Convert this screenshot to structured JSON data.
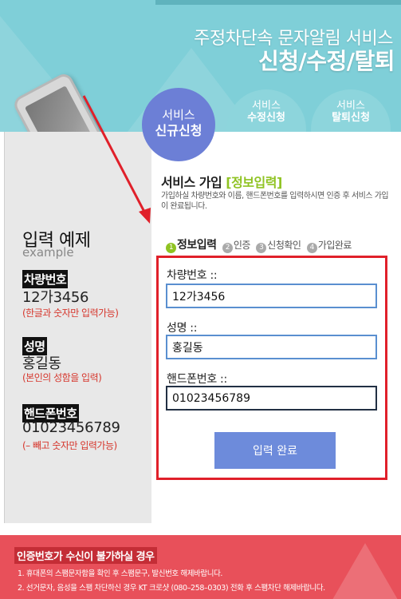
{
  "header": {
    "title_line1": "주정차단속 문자알림 서비스",
    "title_line2": "신청/수정/탈퇴"
  },
  "tabs": [
    {
      "line1": "서비스",
      "line2": "신규신청",
      "active": true
    },
    {
      "line1": "서비스",
      "line2": "수정신청",
      "active": false
    },
    {
      "line1": "서비스",
      "line2": "탈퇴신청",
      "active": false
    }
  ],
  "example": {
    "title": "입력 예제",
    "subtitle": "example",
    "items": [
      {
        "label": "차량번호",
        "value": "12가3456",
        "note": "(한글과 숫자만 입력가능)"
      },
      {
        "label": "성명",
        "value": "홍길동",
        "note": "(본인의 성함을 입력)"
      },
      {
        "label": "핸드폰번호",
        "value": "01023456789",
        "note": "(– 빼고 숫자만 입력가능)"
      }
    ]
  },
  "section": {
    "title": "서비스 가입",
    "title_highlight": "[정보입력]",
    "description": "가입하실 차량번호와 이름, 핸드폰번호를 입력하시면 인증 후 서비스 가입이 완료됩니다."
  },
  "steps": [
    {
      "num": "1",
      "label": "정보입력",
      "active": true
    },
    {
      "num": "2",
      "label": "인증",
      "active": false
    },
    {
      "num": "3",
      "label": "신청확인",
      "active": false
    },
    {
      "num": "4",
      "label": "가입완료",
      "active": false
    }
  ],
  "form": {
    "car_label": "차량번호 ::",
    "car_value": "12가3456",
    "name_label": "성명 ::",
    "name_value": "홍길동",
    "phone_label": "핸드폰번호 ::",
    "phone_value": "01023456789",
    "submit_label": "입력 완료"
  },
  "notice": {
    "title": "인증번호가 수신이 불가하실 경우",
    "line1": "1. 휴대폰의 스팸문자함을 확인 후 스팸문구, 발신번호 해제바랍니다.",
    "line2": "2. 선거문자, 음성을 스팸 차단하신 경우 KT 크로샷 (080–258–0303) 전화 후 스팸차단 해제바랍니다."
  },
  "colors": {
    "header_bg": "#7fcfd8",
    "tab_active": "#6c7fd6",
    "tab_inactive": "#8dd5dc",
    "highlight_green": "#8fc322",
    "form_border": "#e0202a",
    "button": "#6d8bdb",
    "notice_bg": "#e8505a"
  }
}
